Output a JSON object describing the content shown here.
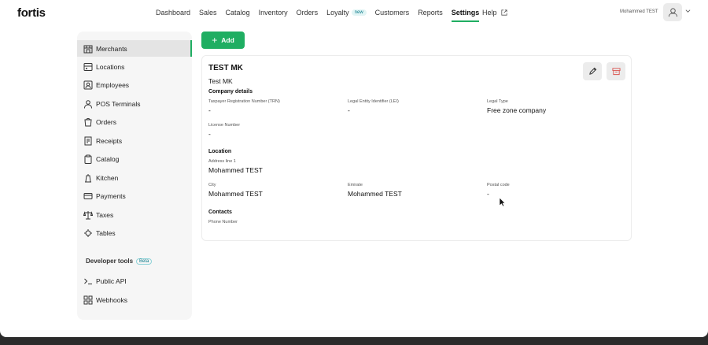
{
  "brand": {
    "logo": "fortis",
    "accent": "#1fae62"
  },
  "nav": {
    "items": [
      {
        "label": "Dashboard"
      },
      {
        "label": "Sales"
      },
      {
        "label": "Catalog"
      },
      {
        "label": "Inventory"
      },
      {
        "label": "Orders"
      },
      {
        "label": "Loyalty",
        "badge": "new"
      },
      {
        "label": "Customers"
      },
      {
        "label": "Reports"
      },
      {
        "label": "Settings",
        "active": true
      }
    ],
    "help": "Help",
    "user_name": "Mohammed TEST"
  },
  "sidebar": {
    "items": [
      {
        "label": "Merchants",
        "icon": "store-icon",
        "active": true
      },
      {
        "label": "Locations",
        "icon": "location-icon"
      },
      {
        "label": "Employees",
        "icon": "employees-icon"
      },
      {
        "label": "POS Terminals",
        "icon": "user-terminal-icon"
      },
      {
        "label": "Orders",
        "icon": "orders-icon"
      },
      {
        "label": "Receipts",
        "icon": "receipt-icon"
      },
      {
        "label": "Catalog",
        "icon": "clipboard-icon"
      },
      {
        "label": "Kitchen",
        "icon": "kitchen-icon"
      },
      {
        "label": "Payments",
        "icon": "card-icon"
      },
      {
        "label": "Taxes",
        "icon": "scale-icon"
      },
      {
        "label": "Tables",
        "icon": "table-icon"
      }
    ],
    "developer": {
      "title": "Developer tools",
      "badge": "Beta",
      "items": [
        {
          "label": "Public API",
          "icon": "terminal-icon"
        },
        {
          "label": "Webhooks",
          "icon": "grid-icon"
        }
      ]
    }
  },
  "actions": {
    "add_label": "Add"
  },
  "merchant": {
    "title": "TEST MK",
    "subtitle": "Test MK",
    "company": {
      "title": "Company details",
      "trn_label": "Taxpayer Registration Number (TRN)",
      "trn_value": "-",
      "lei_label": "Legal Entity Identifier (LEI)",
      "lei_value": "-",
      "legal_type_label": "Legal Type",
      "legal_type_value": "Free zone company",
      "license_label": "License Number",
      "license_value": "-"
    },
    "location": {
      "title": "Location",
      "address_label": "Address line 1",
      "address_value": "Mohammed TEST",
      "city_label": "City",
      "city_value": "Mohammed TEST",
      "emirate_label": "Emirate",
      "emirate_value": "Mohammed TEST",
      "postal_label": "Postal code",
      "postal_value": "-"
    },
    "contacts": {
      "title": "Contacts",
      "phone_label": "Phone Number"
    }
  }
}
